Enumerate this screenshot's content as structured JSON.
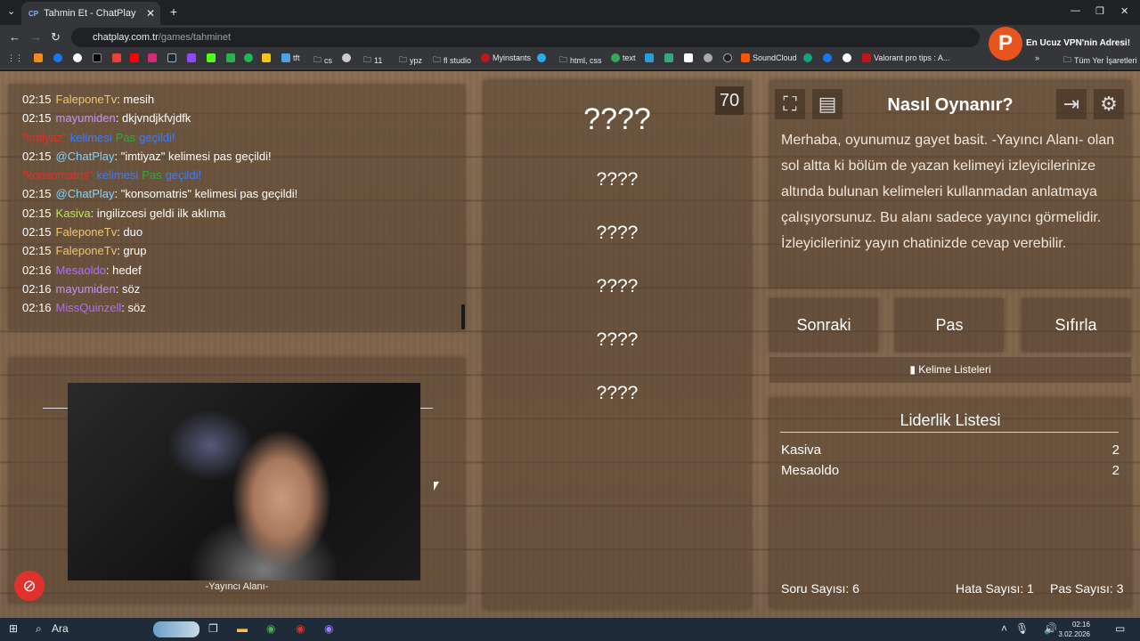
{
  "browser": {
    "tab_title": "Tahmin Et - ChatPlay",
    "tab_favicon": "CP",
    "url_host": "chatplay.com.tr",
    "url_path": "/games/tahminet",
    "bookmarks": [
      "tft",
      "cs",
      "11",
      "ypz",
      "fl studio",
      "Myinstants",
      "html, css",
      "text",
      "SoundCloud",
      "Valorant pro tips : A...",
      "Tüm Yer İşaretleri"
    ],
    "ad_text": "En Ucuz VPN'nin Adresi!",
    "ad_logo": "P"
  },
  "chat": {
    "lines": [
      {
        "time": "02:15",
        "user": "FaleponeTv",
        "color": "#f2c46f",
        "msg": ": mesih"
      },
      {
        "time": "02:15",
        "user": "mayumiden",
        "color": "#c895e8",
        "msg": ": dkjvndjkfvjdfk"
      },
      {
        "time": "",
        "user": "\"imtiyaz\"",
        "color": "#e0302b",
        "msg": "",
        "system": true
      },
      {
        "time": "02:15",
        "user": "@ChatPlay",
        "color": "#7fd4ff",
        "msg": ": \"imtiyaz\" kelimesi pas geçildi!"
      },
      {
        "time": "",
        "user": "\"konsomatris\"",
        "color": "#e0302b",
        "msg": "",
        "system": true
      },
      {
        "time": "02:15",
        "user": "@ChatPlay",
        "color": "#7fd4ff",
        "msg": ": \"konsomatris\" kelimesi pas geçildi!"
      },
      {
        "time": "02:15",
        "user": "Kasiva",
        "color": "#b8e65c",
        "msg": ": ingilizcesi geldi ilk aklıma"
      },
      {
        "time": "02:15",
        "user": "FaleponeTv",
        "color": "#f2c46f",
        "msg": ": duo"
      },
      {
        "time": "02:15",
        "user": "FaleponeTv",
        "color": "#f2c46f",
        "msg": ": grup"
      },
      {
        "time": "02:16",
        "user": "Mesaoldo",
        "color": "#b26bff",
        "msg": ": hedef"
      },
      {
        "time": "02:16",
        "user": "mayumiden",
        "color": "#c895e8",
        "msg": ": söz"
      },
      {
        "time": "02:16",
        "user": "MissQuinzell",
        "color": "#b26bff",
        "msg": ": söz"
      }
    ],
    "system_kelimesi": "kelimesi",
    "system_pas": "Pas",
    "system_gecildi": "geçildi!"
  },
  "video": {
    "label": "-Yayıncı Alanı-"
  },
  "words": {
    "timer": "70",
    "main": "????",
    "items": [
      "????",
      "????",
      "????",
      "????",
      "????"
    ]
  },
  "howto": {
    "title": "Nasıl Oynanır?",
    "text": "Merhaba, oyunumuz gayet basit. -Yayıncı Alanı- olan sol altta ki bölüm de yazan kelimeyi izleyicilerinize altında bulunan kelimeleri kullanmadan anlatmaya çalışıyorsunuz. Bu alanı sadece yayıncı görmelidir. İzleyicileriniz yayın chatinizde cevap verebilir."
  },
  "actions": {
    "next": "Sonraki",
    "pass": "Pas",
    "reset": "Sıfırla",
    "lists": "Kelime Listeleri"
  },
  "leaderboard": {
    "title": "Liderlik Listesi",
    "rows": [
      {
        "name": "Kasiva",
        "score": "2"
      },
      {
        "name": "Mesaoldo",
        "score": "2"
      }
    ],
    "questions": "Soru Sayısı: 6",
    "errors": "Hata Sayısı: 1",
    "passes": "Pas Sayısı: 3"
  },
  "taskbar": {
    "search": "Ara",
    "time": "02:16",
    "date": "3.02.2026"
  }
}
